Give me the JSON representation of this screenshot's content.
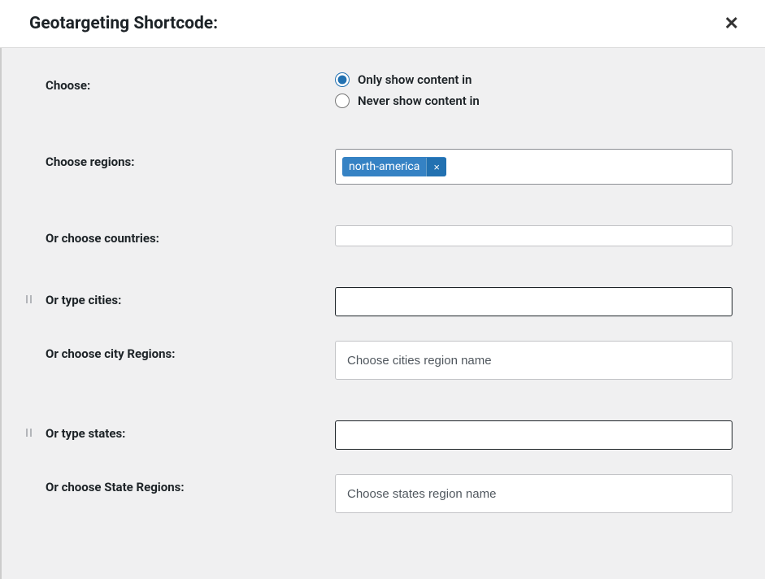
{
  "header": {
    "title": "Geotargeting Shortcode:"
  },
  "form": {
    "choose": {
      "label": "Choose:",
      "options": {
        "only_show": "Only show content in",
        "never_show": "Never show content in"
      },
      "selected": "only_show"
    },
    "regions": {
      "label": "Choose regions:",
      "tags": [
        "north-america"
      ]
    },
    "countries": {
      "label": "Or choose countries:"
    },
    "cities": {
      "label": "Or type cities:"
    },
    "city_regions": {
      "label": "Or choose city Regions:",
      "placeholder": "Choose cities region name"
    },
    "states": {
      "label": "Or type states:"
    },
    "state_regions": {
      "label": "Or choose State Regions:",
      "placeholder": "Choose states region name"
    }
  }
}
